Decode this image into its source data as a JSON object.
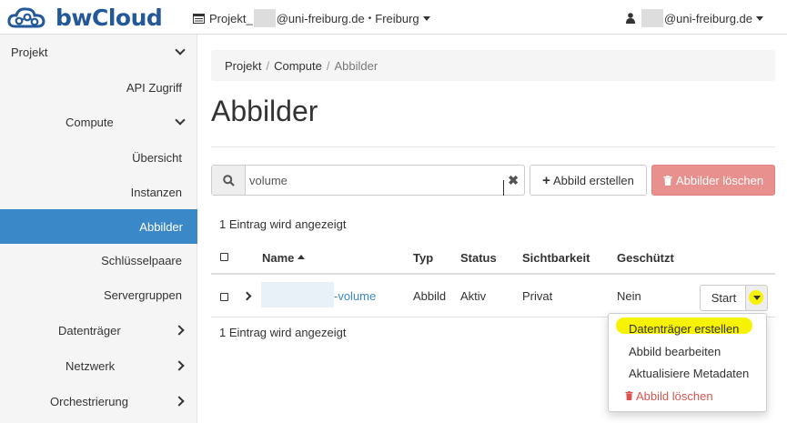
{
  "app": {
    "brand": "bwCloud"
  },
  "header": {
    "project_prefix": "Projekt_",
    "project_domain": "@uni-freiburg.de",
    "region_sep": "•",
    "region": "Freiburg",
    "user_domain": "@uni-freiburg.de"
  },
  "sidebar": {
    "projekt": "Projekt",
    "api": "API Zugriff",
    "compute": "Compute",
    "uebersicht": "Übersicht",
    "instanzen": "Instanzen",
    "abbilder": "Abbilder",
    "schluessel": "Schlüsselpaare",
    "server": "Servergruppen",
    "datentraeger": "Datenträger",
    "netzwerk": "Netzwerk",
    "orchestrierung": "Orchestrierung"
  },
  "breadcrumb": {
    "items": [
      "Projekt",
      "Compute"
    ],
    "current": "Abbilder",
    "sep": "/"
  },
  "page_title": "Abbilder",
  "search": {
    "value": "volume",
    "clear": "✖"
  },
  "actions": {
    "create": "Abbild erstellen",
    "delete": "Abbilder löschen"
  },
  "table": {
    "count_top": "1 Eintrag wird angezeigt",
    "count_bottom": "1 Eintrag wird angezeigt",
    "headers": {
      "name": "Name",
      "typ": "Typ",
      "status": "Status",
      "sichtbarkeit": "Sichtbarkeit",
      "geschuetzt": "Geschützt"
    },
    "rows": [
      {
        "name_suffix": "-volume",
        "typ": "Abbild",
        "status": "Aktiv",
        "sichtbarkeit": "Privat",
        "geschuetzt": "Nein",
        "action": "Start"
      }
    ]
  },
  "dropdown": {
    "items": [
      "Datenträger erstellen",
      "Abbild bearbeiten",
      "Aktualisiere Metadaten"
    ],
    "danger": "Abbild löschen"
  },
  "colors": {
    "brand": "#23599a",
    "active": "#3b88c8",
    "danger": "#d9534f",
    "highlight": "#f7f300"
  }
}
